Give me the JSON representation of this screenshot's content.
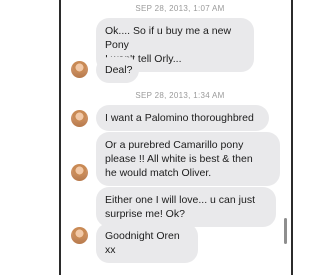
{
  "conversation": {
    "timestamps": [
      "SEP 28, 2013, 1:07 AM",
      "SEP 28, 2013, 1:34 AM"
    ],
    "messages": [
      {
        "text": "Ok.... So if u buy me a new Pony\nI won't tell Orly..."
      },
      {
        "text": "Deal?"
      },
      {
        "text": "I want a Palomino thoroughbred"
      },
      {
        "text": "Or a purebred Camarillo pony\nplease !!  All white is best & then\nhe would match Oliver."
      },
      {
        "text": "Either one I will love... u can just\nsurprise me! Ok?"
      },
      {
        "text": "Goodnight Oren xx"
      }
    ]
  }
}
